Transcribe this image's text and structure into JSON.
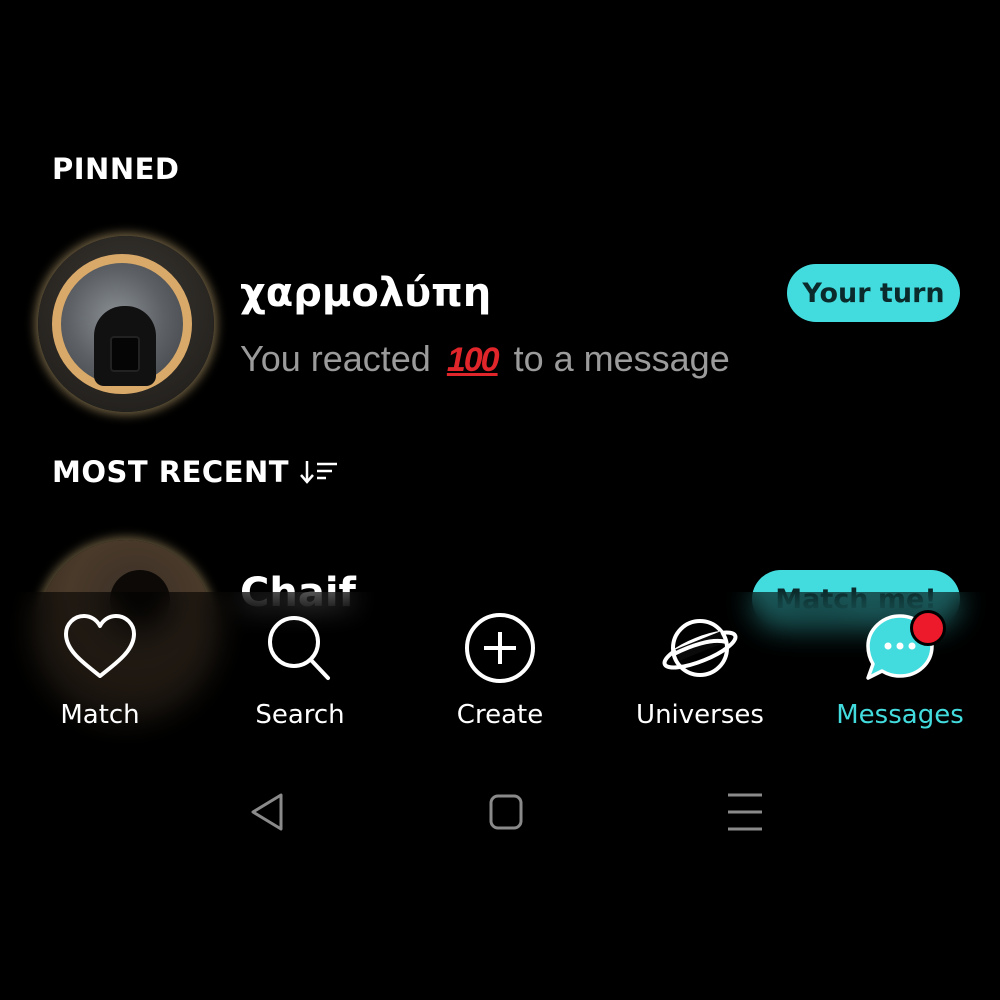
{
  "sections": {
    "pinned_label": "PINNED",
    "most_recent_label": "MOST RECENT"
  },
  "pinned_conversation": {
    "name": "χαρμολύπη",
    "preview_prefix": "You reacted",
    "preview_emoji": "100",
    "preview_suffix": "to a message",
    "action_label": "Your turn"
  },
  "recent_conversation": {
    "name": "Chaif",
    "action_label": "Match me!"
  },
  "bottom_nav": {
    "items": [
      {
        "label": "Match",
        "icon": "heart-icon",
        "active": false
      },
      {
        "label": "Search",
        "icon": "search-icon",
        "active": false
      },
      {
        "label": "Create",
        "icon": "plus-circle-icon",
        "active": false
      },
      {
        "label": "Universes",
        "icon": "planet-icon",
        "active": false
      },
      {
        "label": "Messages",
        "icon": "chat-bubble-icon",
        "active": true
      }
    ],
    "accent_color": "#43dcde",
    "badge_color": "#ec1a2b"
  },
  "system_nav": {
    "icons": [
      "back-icon",
      "home-icon",
      "recents-icon"
    ]
  }
}
